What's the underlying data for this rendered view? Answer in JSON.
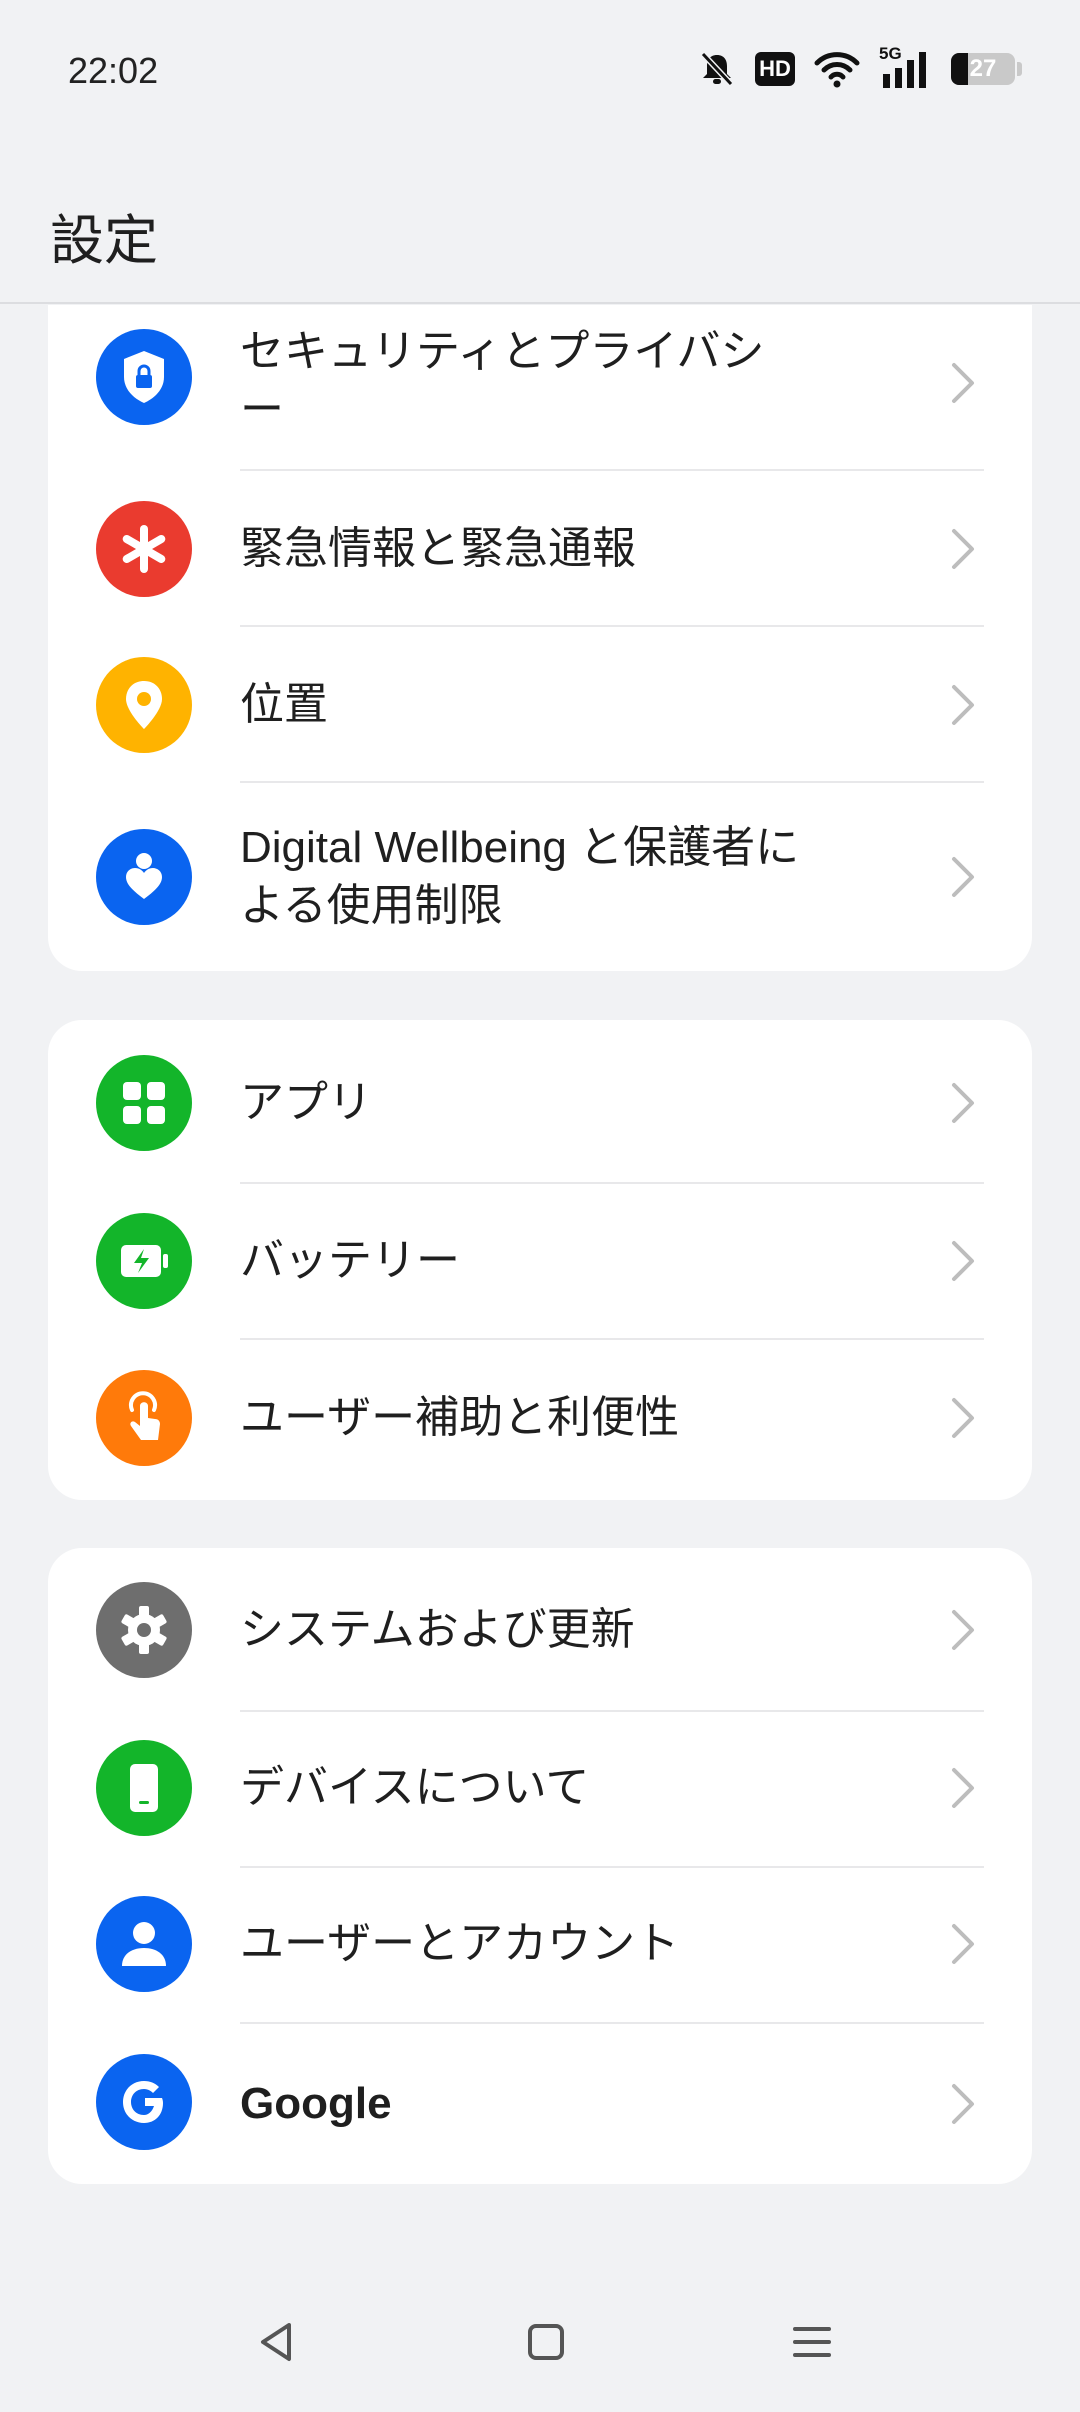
{
  "status_bar": {
    "time": "22:02",
    "network_type": "5G",
    "hd_label": "HD",
    "battery_percent": "27",
    "battery_level": 0.27
  },
  "header": {
    "title": "設定"
  },
  "groups": [
    {
      "items": [
        {
          "label": "セキュリティとプライバシ\nー",
          "icon": "shield-lock-icon",
          "color": "#0a64f0"
        },
        {
          "label": "緊急情報と緊急通報",
          "icon": "asterisk-icon",
          "color": "#ea3b2f"
        },
        {
          "label": "位置",
          "icon": "location-pin-icon",
          "color": "#ffb300"
        },
        {
          "label": "Digital Wellbeing と保護者に\nよる使用制限",
          "icon": "person-heart-icon",
          "color": "#0a64f0"
        }
      ]
    },
    {
      "items": [
        {
          "label": "アプリ",
          "icon": "apps-grid-icon",
          "color": "#13b52a"
        },
        {
          "label": "バッテリー",
          "icon": "battery-charging-icon",
          "color": "#13b52a"
        },
        {
          "label": "ユーザー補助と利便性",
          "icon": "touch-hand-icon",
          "color": "#ff7a0a"
        }
      ]
    },
    {
      "items": [
        {
          "label": "システムおよび更新",
          "icon": "gear-icon",
          "color": "#6e6e6e"
        },
        {
          "label": "デバイスについて",
          "icon": "phone-device-icon",
          "color": "#13b52a"
        },
        {
          "label": "ユーザーとアカウント",
          "icon": "user-icon",
          "color": "#0a64f0"
        },
        {
          "label": "Google",
          "icon": "google-icon",
          "color": "#0a64f0"
        }
      ]
    }
  ],
  "nav_bar": {
    "back_icon": "back-triangle-icon",
    "home_icon": "home-square-icon",
    "recents_icon": "menu-lines-icon"
  }
}
